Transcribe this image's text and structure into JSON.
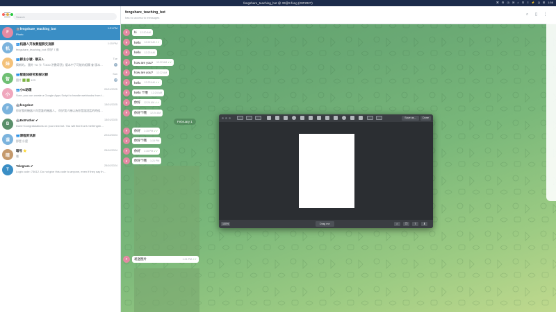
{
  "window": {
    "title": "fengshare_teaching_bot @ 33@9 fong (23F2027)",
    "tray": [
      "⌘",
      "⚙",
      "◷",
      "✉",
      "⌂",
      "☰",
      "≡",
      "⚡",
      "Q",
      "⊞",
      "1:56"
    ],
    "traffic_lights": [
      "#ff5f57",
      "#febc2e",
      "#28c840"
    ]
  },
  "sidebar": {
    "search_placeholder": "Search",
    "chats": [
      {
        "initial": "F",
        "color": "#e58aa3",
        "name": "🤖fengshare_teaching_bot",
        "time": "1:21 PM",
        "preview": "Photo",
        "active": true,
        "badge": ""
      },
      {
        "initial": "机",
        "color": "#7bb3dd",
        "name": "👥机器人开发教程群交流群",
        "time": "1:15 PM",
        "preview": "fengshare_teaching_bot: 你好 7 歲",
        "active": false,
        "badge": ""
      },
      {
        "initial": "妹",
        "color": "#f4c27a",
        "name": "👥群主小號 · 聊天 L",
        "time": "Tue",
        "preview": "搞新的。 國外 TG 卡「ODD 洪數奇頂」版本中了可能的相關 會 版本…",
        "active": false,
        "badge": "7"
      },
      {
        "initial": "智",
        "color": "#6fbf73",
        "name": "👥智能体研究和探讨群",
        "time": "Sun",
        "preview": "图片 🟩 🟩 123",
        "active": false,
        "badge": "12"
      },
      {
        "initial": "小",
        "color": "#f0a7bd",
        "name": "👥小K助理",
        "time": "20/01/2025",
        "preview": "Sure, you can create a Google Apps Script to handle webhooks from t…",
        "active": false,
        "badge": ""
      },
      {
        "initial": "F",
        "color": "#7bb3dd",
        "name": "🤖fengsbot",
        "time": "13/01/2025",
        "preview": "你好我的機器人你是誰的機器人。 你好我人機以為你是誰說話的時候…",
        "active": false,
        "badge": ""
      },
      {
        "initial": "B",
        "color": "#5a8f6a",
        "name": "🤖BotFather ✔",
        "time": "13/01/2025",
        "preview": "Done! Congratulations on your new bot. You will find it at t.me/fengsh…",
        "active": false,
        "badge": ""
      },
      {
        "initial": "课",
        "color": "#7bb3dd",
        "name": "👥课程资讯群",
        "time": "22/12/2024",
        "preview": "那是 什麼",
        "active": false,
        "badge": ""
      },
      {
        "initial": "暗",
        "color": "#c59a6d",
        "name": "暗号 ⭐",
        "time": "25/10/2024",
        "preview": "嗯",
        "active": false,
        "badge": ""
      },
      {
        "initial": "T",
        "color": "#3a8ec5",
        "name": "Telegram ✔",
        "time": "25/10/2024",
        "preview": "Login code: 73612. Do not give this code to anyone, even if they say th…",
        "active": false,
        "badge": ""
      }
    ]
  },
  "chat": {
    "title": "fengshare_teaching_bot",
    "subtitle": "has no access to messages",
    "messages": [
      {
        "text": "hi",
        "time": "12:20 AM",
        "check": ""
      },
      {
        "text": "hello",
        "time": "12:22 AM",
        "check": "✓✓"
      },
      {
        "text": "hello",
        "time": "12:23 AM",
        "check": ""
      },
      {
        "text": "how are you?",
        "time": "12:22 AM",
        "check": "✓✓"
      },
      {
        "text": "how are you?",
        "time": "12:22 AM",
        "check": ""
      },
      {
        "text": "hello",
        "time": "12:23 AM",
        "check": "✓✓"
      },
      {
        "text": "hello 个哦",
        "time": "12:24 AM",
        "check": ""
      },
      {
        "text": "你好",
        "time": "12:24 AM",
        "check": "✓✓"
      },
      {
        "text": "你好个哦",
        "time": "12:24 AM",
        "check": ""
      }
    ],
    "date_divider": "February 1",
    "messages2": [
      {
        "text": "你好",
        "time": "1:15 PM",
        "check": "✓✓"
      },
      {
        "text": "你好个哦",
        "time": "1:15 PM",
        "check": ""
      },
      {
        "text": "你好",
        "time": "1:15 PM",
        "check": "✓✓"
      },
      {
        "text": "你好个哦",
        "time": "1:21 PM",
        "check": ""
      }
    ],
    "last_message": {
      "text": "发送图片",
      "time": "1:21 PM",
      "check": "✓✓"
    },
    "avatar_initial": "F"
  },
  "editor": {
    "save_label": "Save as...",
    "done_label": "Done",
    "zoom": "100%",
    "drag_label": "Drag me"
  }
}
